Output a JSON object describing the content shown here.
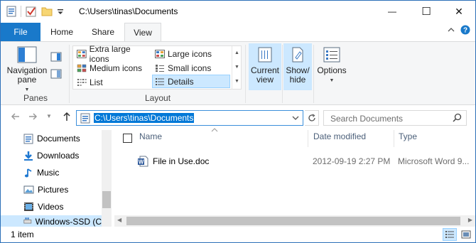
{
  "window": {
    "title": "C:\\Users\\tinas\\Documents",
    "minimize_glyph": "—",
    "maximize_glyph": "☐",
    "close_glyph": "✕"
  },
  "tabs": {
    "file": "File",
    "home": "Home",
    "share": "Share",
    "view": "View"
  },
  "ribbon": {
    "panes": {
      "navigation_pane_line1": "Navigation",
      "navigation_pane_line2": "pane",
      "group_label": "Panes"
    },
    "layout": {
      "group_label": "Layout",
      "items": [
        "Extra large icons",
        "Large icons",
        "Medium icons",
        "Small icons",
        "List",
        "Details"
      ],
      "selected": "Details"
    },
    "current_view": {
      "line1": "Current",
      "line2": "view"
    },
    "show_hide": {
      "line1": "Show/",
      "line2": "hide"
    },
    "options": {
      "label": "Options"
    }
  },
  "address": {
    "path": "C:\\Users\\tinas\\Documents",
    "search_placeholder": "Search Documents"
  },
  "nav_pane": {
    "items": [
      {
        "label": "Documents",
        "icon": "documents-icon"
      },
      {
        "label": "Downloads",
        "icon": "downloads-icon"
      },
      {
        "label": "Music",
        "icon": "music-icon"
      },
      {
        "label": "Pictures",
        "icon": "pictures-icon"
      },
      {
        "label": "Videos",
        "icon": "videos-icon"
      },
      {
        "label": "Windows-SSD (C",
        "icon": "drive-icon"
      }
    ],
    "selected": "Windows-SSD (C"
  },
  "file_list": {
    "columns": {
      "name": "Name",
      "date": "Date modified",
      "type": "Type"
    },
    "rows": [
      {
        "name": "File in Use.doc",
        "date": "2012-09-19 2:27 PM",
        "type": "Microsoft Word 9..."
      }
    ]
  },
  "status": {
    "text": "1 item"
  },
  "colors": {
    "accent": "#1979ca",
    "selection": "#cce8ff",
    "selection_border": "#99d1ff"
  }
}
